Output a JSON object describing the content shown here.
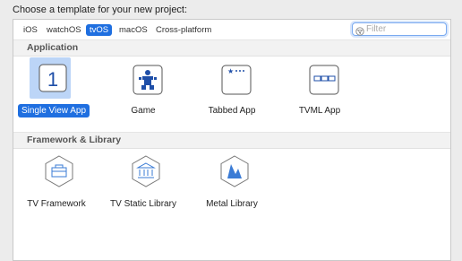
{
  "heading": "Choose a template for your new project:",
  "tabs": [
    {
      "label": "iOS",
      "selected": false
    },
    {
      "label": "watchOS",
      "selected": false
    },
    {
      "label": "tvOS",
      "selected": true
    },
    {
      "label": "macOS",
      "selected": false
    },
    {
      "label": "Cross-platform",
      "selected": false
    }
  ],
  "filter": {
    "placeholder": "Filter",
    "value": ""
  },
  "sections": [
    {
      "title": "Application",
      "templates": [
        {
          "label": "Single View App",
          "icon": "single-view-icon",
          "glyph": "1",
          "selected": true
        },
        {
          "label": "Game",
          "icon": "game-icon",
          "selected": false
        },
        {
          "label": "Tabbed App",
          "icon": "tabbed-app-icon",
          "selected": false
        },
        {
          "label": "TVML App",
          "icon": "tvml-app-icon",
          "selected": false
        }
      ]
    },
    {
      "title": "Framework & Library",
      "templates": [
        {
          "label": "TV Framework",
          "icon": "framework-icon",
          "selected": false
        },
        {
          "label": "TV Static Library",
          "icon": "static-library-icon",
          "selected": false
        },
        {
          "label": "Metal Library",
          "icon": "metal-library-icon",
          "selected": false
        }
      ]
    }
  ],
  "colors": {
    "accent": "#1f6fe0",
    "selection_bg": "#bcd5f7",
    "icon_blue": "#3a7bd5"
  }
}
